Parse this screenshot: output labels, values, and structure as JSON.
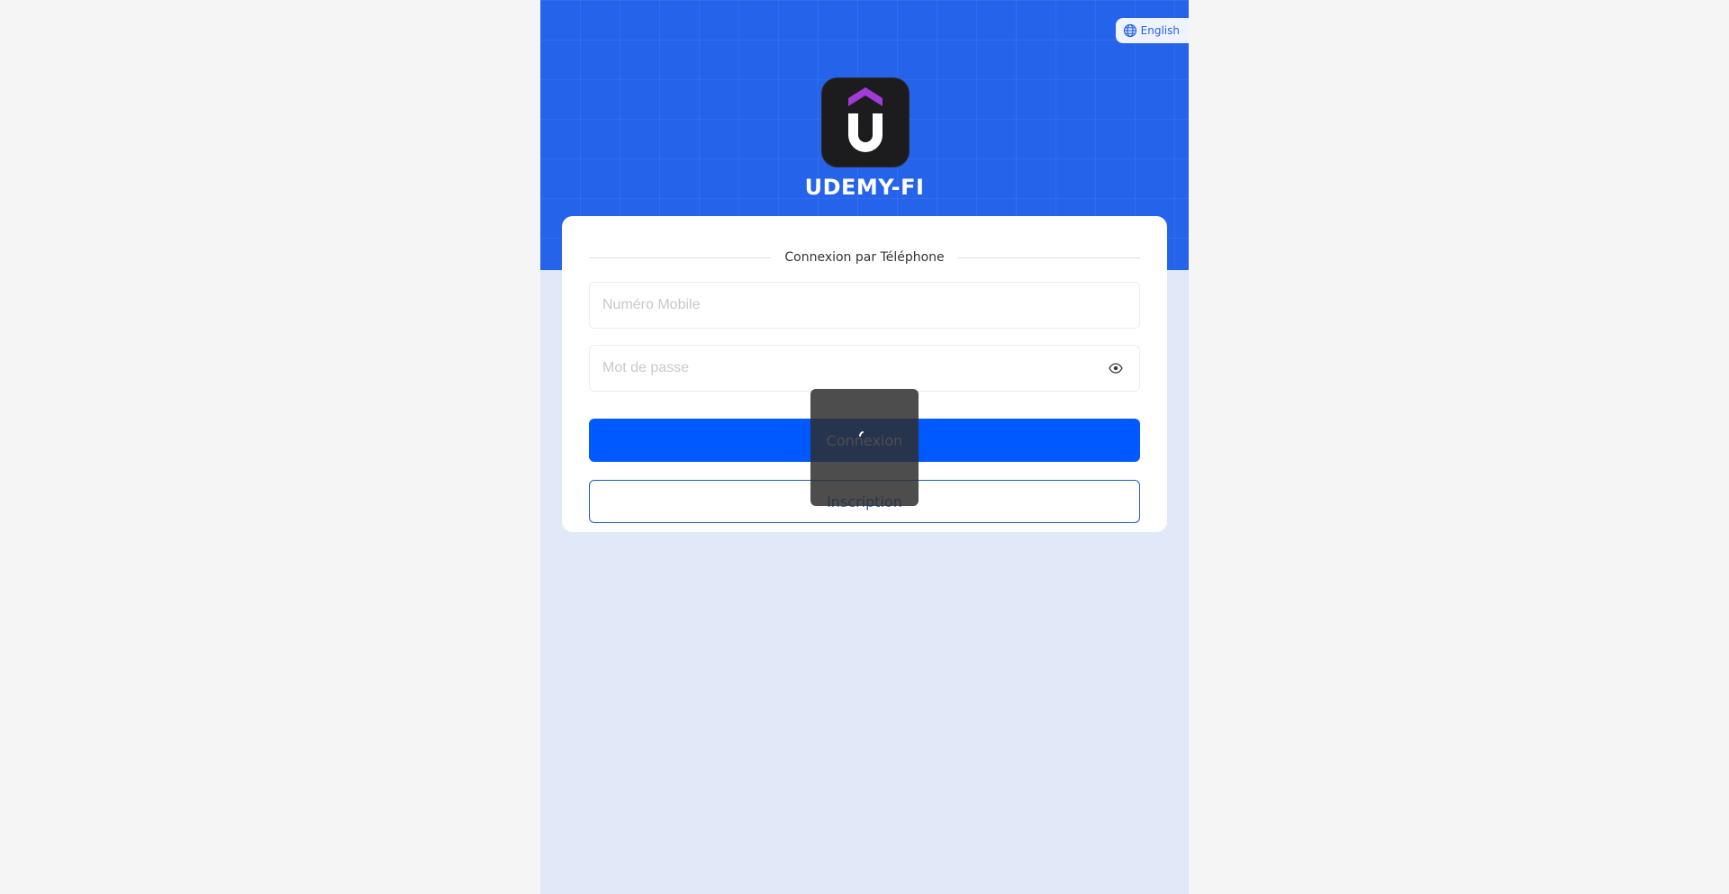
{
  "language_switch": {
    "label": "English",
    "icon": "globe-icon"
  },
  "brand": {
    "name": "UDEMY-FI",
    "logo_icon": "udemy-u-logo"
  },
  "login_form": {
    "section_title": "Connexion par Téléphone",
    "mobile": {
      "placeholder": "Numéro Mobile",
      "value": ""
    },
    "password": {
      "placeholder": "Mot de passe",
      "value": "",
      "toggle_icon": "eye-icon"
    },
    "login_label": "Connexion",
    "register_label": "Inscription"
  },
  "loading_toast": {
    "icon": "loading-spinner-icon"
  },
  "colors": {
    "hero": "#2563eb",
    "primary_button": "#0058ff",
    "outline_button": "#1f5fbf",
    "logo_accent": "#a23ad8",
    "page_background": "#e1e9f8"
  }
}
